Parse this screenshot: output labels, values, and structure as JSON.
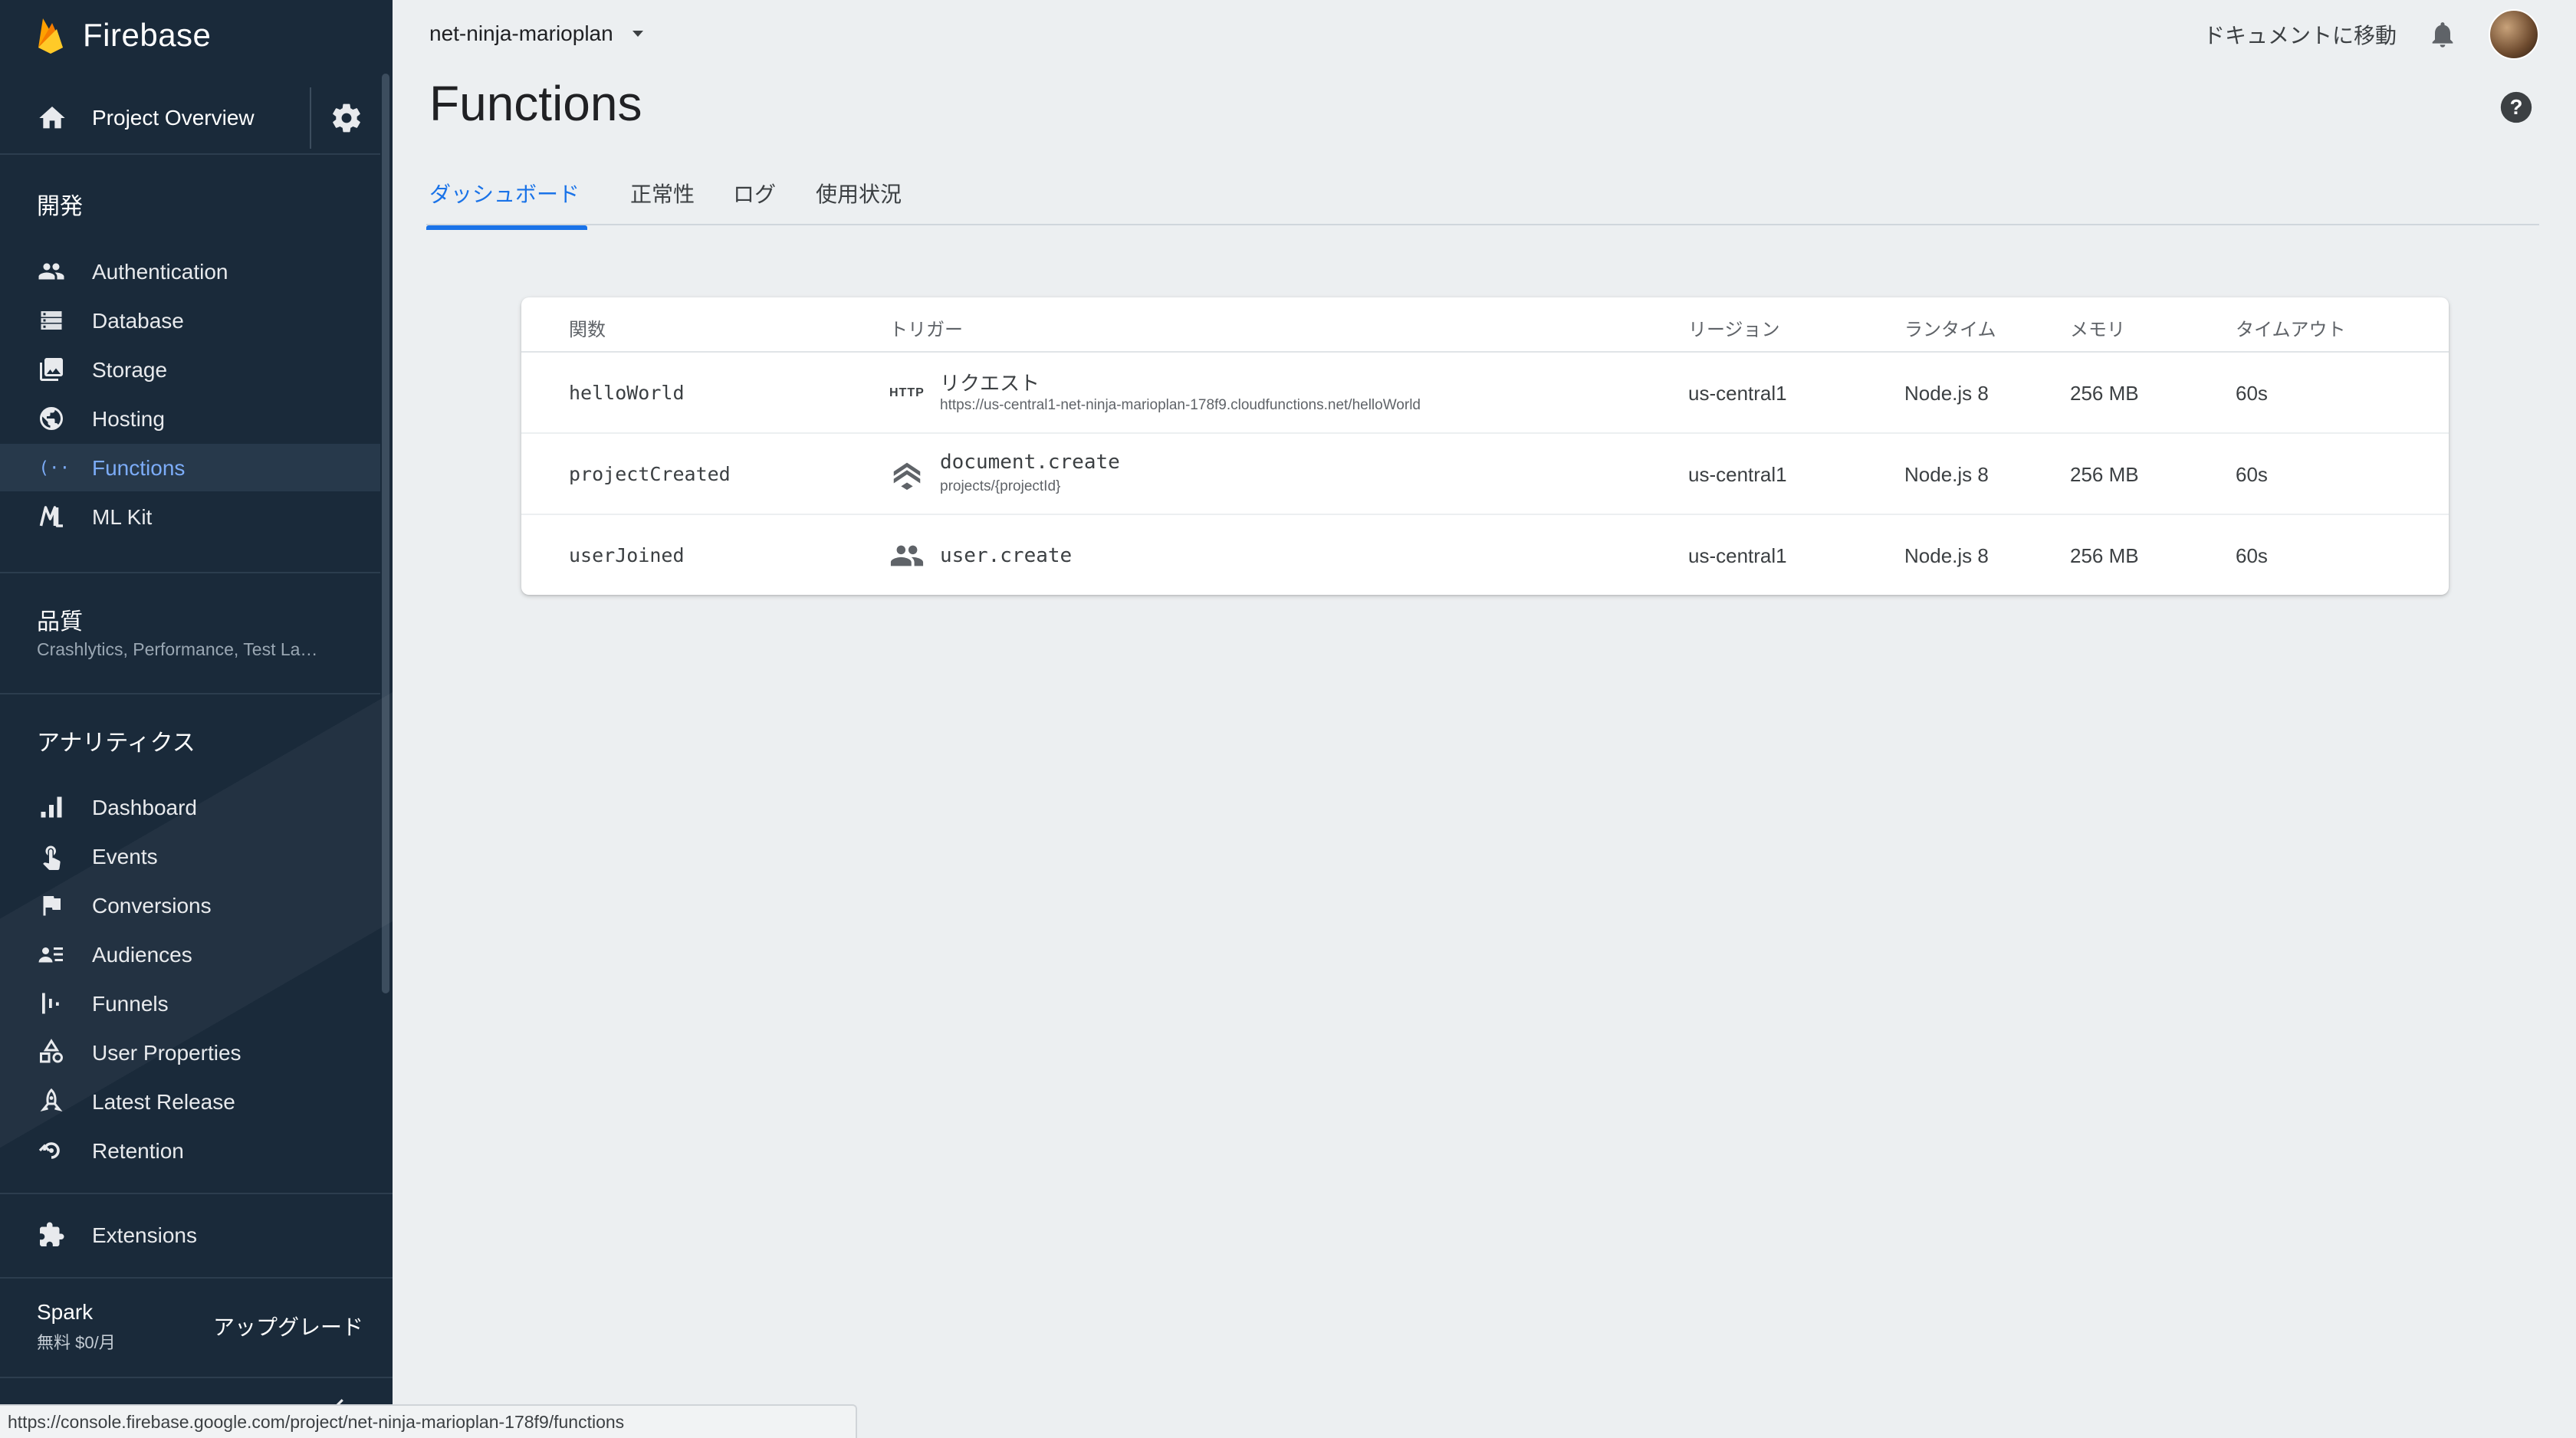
{
  "sidebar": {
    "brand": "Firebase",
    "project_overview": "Project Overview",
    "sections": {
      "develop": "開発",
      "quality": "品質",
      "quality_sub": "Crashlytics, Performance, Test La…",
      "analytics": "アナリティクス"
    },
    "develop_items": [
      {
        "label": "Authentication",
        "icon": "people-icon"
      },
      {
        "label": "Database",
        "icon": "database-icon"
      },
      {
        "label": "Storage",
        "icon": "image-icon"
      },
      {
        "label": "Hosting",
        "icon": "globe-icon"
      },
      {
        "label": "Functions",
        "icon": "functions-icon",
        "active": true
      },
      {
        "label": "ML Kit",
        "icon": "ml-kit-icon"
      }
    ],
    "analytics_items": [
      {
        "label": "Dashboard",
        "icon": "bar-chart-icon"
      },
      {
        "label": "Events",
        "icon": "touch-icon"
      },
      {
        "label": "Conversions",
        "icon": "flag-icon"
      },
      {
        "label": "Audiences",
        "icon": "audiences-icon"
      },
      {
        "label": "Funnels",
        "icon": "funnel-icon"
      },
      {
        "label": "User Properties",
        "icon": "shapes-icon"
      },
      {
        "label": "Latest Release",
        "icon": "rocket-icon"
      },
      {
        "label": "Retention",
        "icon": "retention-icon"
      }
    ],
    "extensions": "Extensions",
    "plan": {
      "name": "Spark",
      "price": "無料 $0/月",
      "upgrade": "アップグレード"
    }
  },
  "header": {
    "project": "net-ninja-marioplan",
    "docs_link": "ドキュメントに移動",
    "title": "Functions"
  },
  "tabs": [
    {
      "label": "ダッシュボード",
      "active": true
    },
    {
      "label": "正常性"
    },
    {
      "label": "ログ"
    },
    {
      "label": "使用状況"
    }
  ],
  "table": {
    "columns": [
      "関数",
      "トリガー",
      "リージョン",
      "ランタイム",
      "メモリ",
      "タイムアウト"
    ],
    "rows": [
      {
        "name": "helloWorld",
        "trigger_type": "HTTP",
        "trigger": "リクエスト",
        "trigger_detail": "https://us-central1-net-ninja-marioplan-178f9.cloudfunctions.net/helloWorld",
        "region": "us-central1",
        "runtime": "Node.js 8",
        "memory": "256 MB",
        "timeout": "60s"
      },
      {
        "name": "projectCreated",
        "trigger_type": "firestore",
        "trigger": "document.create",
        "trigger_detail": "projects/{projectId}",
        "region": "us-central1",
        "runtime": "Node.js 8",
        "memory": "256 MB",
        "timeout": "60s"
      },
      {
        "name": "userJoined",
        "trigger_type": "auth",
        "trigger": "user.create",
        "trigger_detail": "",
        "region": "us-central1",
        "runtime": "Node.js 8",
        "memory": "256 MB",
        "timeout": "60s"
      }
    ]
  },
  "status_bar": {
    "url": "https://console.firebase.google.com/project/net-ninja-marioplan-178f9/functions"
  },
  "colors": {
    "sidebar_bg": "#1a2a3a",
    "accent": "#1a73e8",
    "active_nav": "#7cacf8",
    "main_bg": "#eceff1"
  }
}
